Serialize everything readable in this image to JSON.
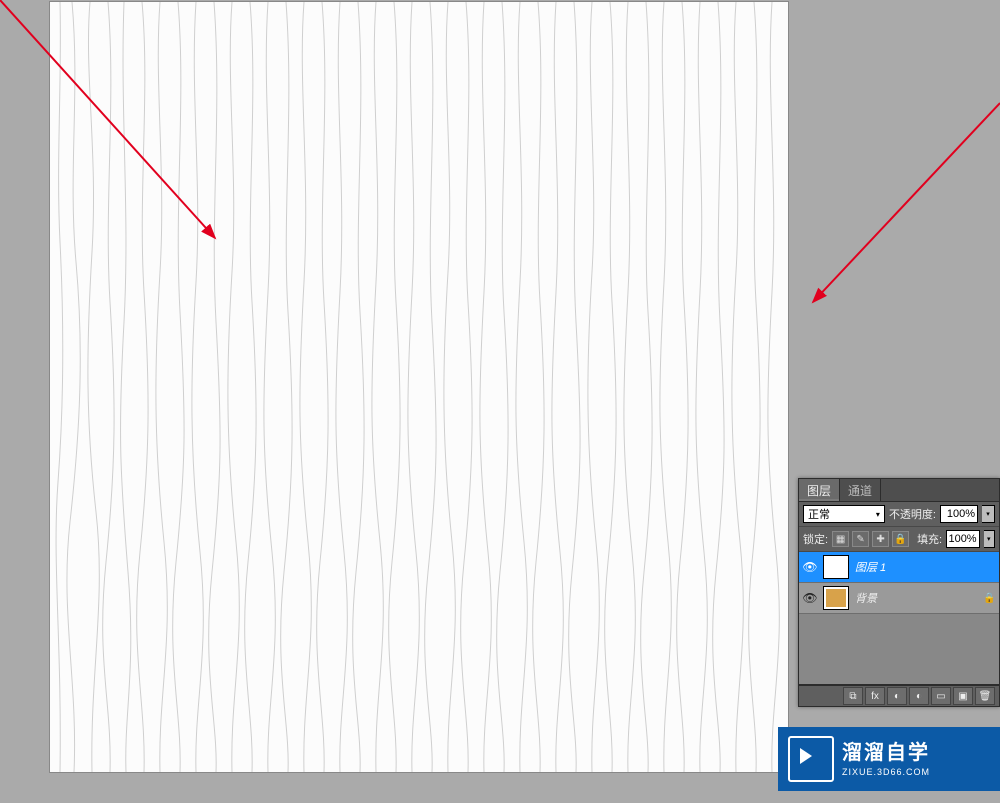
{
  "layers_panel": {
    "tabs": [
      "图层",
      "通道"
    ],
    "blend_mode": "正常",
    "opacity_label": "不透明度:",
    "opacity_value": "100%",
    "lock_label": "锁定:",
    "fill_label": "填充:",
    "fill_value": "100%",
    "layers": [
      {
        "name": "图层 1",
        "thumb": "white",
        "locked": false,
        "selected": true
      },
      {
        "name": "背景",
        "thumb": "bg",
        "locked": true,
        "selected": false
      }
    ]
  },
  "badge": {
    "title": "溜溜自学",
    "url": "ZIXUE.3D66.COM"
  },
  "icons": {
    "eye": "👁",
    "caret": "▾",
    "lock": "🔒",
    "fx": "fx",
    "mask": "◐",
    "folder": "▭",
    "new": "▣",
    "trash": "🗑",
    "link": "⧉",
    "px": "▦",
    "plus": "✚",
    "lockp": "🔒"
  }
}
